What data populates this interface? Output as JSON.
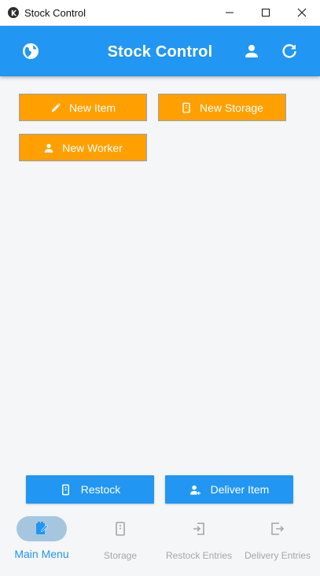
{
  "window": {
    "title": "Stock Control",
    "icon": "kivy-logo-icon",
    "controls": [
      "minimize-icon",
      "maximize-icon",
      "close-icon"
    ]
  },
  "appbar": {
    "title": "Stock Control",
    "left_icon": "globe-icon",
    "right_icons": [
      "person-icon",
      "refresh-icon"
    ]
  },
  "actions": {
    "new_item": "New Item",
    "new_storage": "New Storage",
    "new_worker": "New Worker"
  },
  "bottom_actions": {
    "restock": "Restock",
    "deliver_item": "Deliver Item"
  },
  "bottom_nav": {
    "selected": "Main Menu",
    "items": [
      {
        "label": "Main Menu",
        "icon": "inventory-icon"
      },
      {
        "label": "Storage",
        "icon": "storage-cabinet-icon"
      },
      {
        "label": "Restock Entries",
        "icon": "login-icon"
      },
      {
        "label": "Delivery Entries",
        "icon": "logout-icon"
      }
    ]
  },
  "colors": {
    "primary": "#2196f3",
    "accent": "#ffa000",
    "background": "#f5f6f8",
    "inactive": "#a6a6a6",
    "nav_active_pill": "#a6c6e0"
  }
}
